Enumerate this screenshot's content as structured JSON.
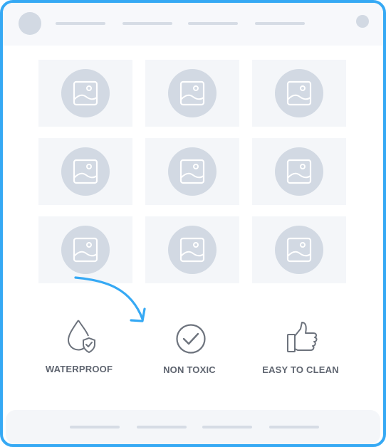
{
  "header": {
    "nav_items": [
      "",
      "",
      "",
      ""
    ]
  },
  "gallery": {
    "tiles": [
      {
        "icon": "image-placeholder-icon"
      },
      {
        "icon": "image-placeholder-icon"
      },
      {
        "icon": "image-placeholder-icon"
      },
      {
        "icon": "image-placeholder-icon"
      },
      {
        "icon": "image-placeholder-icon"
      },
      {
        "icon": "image-placeholder-icon"
      },
      {
        "icon": "image-placeholder-icon"
      },
      {
        "icon": "image-placeholder-icon"
      },
      {
        "icon": "image-placeholder-icon"
      }
    ]
  },
  "features": [
    {
      "label": "WATERPROOF",
      "icon": "water-drop-shield-icon"
    },
    {
      "label": "NON TOXIC",
      "icon": "check-circle-icon"
    },
    {
      "label": "EASY TO CLEAN",
      "icon": "thumbs-up-icon"
    }
  ],
  "colors": {
    "accent": "#36a9f4",
    "placeholder": "#d2d9e3",
    "tile_bg": "#f4f6f9",
    "text": "#5f6570"
  }
}
